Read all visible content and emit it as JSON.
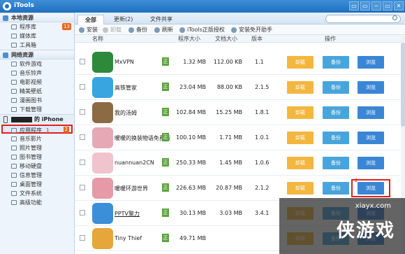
{
  "app": {
    "title": "iTools"
  },
  "window_buttons": [
    "▭",
    "▭",
    "─",
    "▭",
    "✕"
  ],
  "sidebar": {
    "local_section": "本地资源",
    "local_items": [
      {
        "label": "程序库",
        "badge": "13"
      },
      {
        "label": "媒体库"
      },
      {
        "label": "工具箱"
      }
    ],
    "network_section": "网络资源",
    "network_items": [
      {
        "label": "软件游戏"
      },
      {
        "label": "音乐铃声"
      },
      {
        "label": "电影视频"
      },
      {
        "label": "精美壁纸"
      },
      {
        "label": "漫画图书"
      },
      {
        "label": "下载管理"
      }
    ],
    "device_label": "的 iPhone",
    "device_items": [
      {
        "label": "应用程序",
        "num1": "1",
        "num2": "2"
      },
      {
        "label": "音乐影片"
      },
      {
        "label": "照片管理"
      },
      {
        "label": "图书管理"
      },
      {
        "label": "移动硬盘"
      },
      {
        "label": "信息管理"
      },
      {
        "label": "桌面管理"
      },
      {
        "label": "文件系统"
      },
      {
        "label": "高级功能"
      }
    ]
  },
  "tabs": [
    {
      "label": "全部"
    },
    {
      "label": "更新(2)"
    },
    {
      "label": "文件共享"
    }
  ],
  "toolbar": {
    "install": "安装",
    "uninstall": "卸载",
    "backup": "备份",
    "refresh": "刷新",
    "itools_auth": "iTools正版授权",
    "jailbreak_free": "安装免开助手"
  },
  "table_headers": {
    "name": "名称",
    "program_size": "程序大小",
    "doc_size": "文档大小",
    "version": "版本",
    "actions": "操作"
  },
  "row_buttons": {
    "uninstall": "卸载",
    "backup": "备份",
    "browse": "浏览"
  },
  "verified_label": "正",
  "rows": [
    {
      "name": "MxVPN",
      "program_size": "1.32 MB",
      "doc_size": "112.00 KB",
      "version": "1.1",
      "color": "#2c8a3a"
    },
    {
      "name": "高铁管家",
      "program_size": "23.04 MB",
      "doc_size": "88.00 KB",
      "version": "2.1.5",
      "color": "#38a5e0"
    },
    {
      "name": "我的汤姆",
      "program_size": "102.84 MB",
      "doc_size": "15.25 MB",
      "version": "1.8.1",
      "color": "#8c6a44"
    },
    {
      "name": "暖暖的换装物语免费版",
      "program_size": "100.10 MB",
      "doc_size": "1.71 MB",
      "version": "1.0.1",
      "color": "#e7a8b6"
    },
    {
      "name": "nuannuan2CN",
      "program_size": "250.33 MB",
      "doc_size": "1.45 MB",
      "version": "1.0.6",
      "color": "#f0c4cd"
    },
    {
      "name": "暖暖环游世界",
      "program_size": "226.63 MB",
      "doc_size": "20.87 MB",
      "version": "2.1.2",
      "color": "#e69aa8",
      "highlight": "2"
    },
    {
      "name": "PPTV聚力",
      "program_size": "30.13 MB",
      "doc_size": "3.03 MB",
      "version": "3.4.1",
      "color": "#3a8fd8"
    },
    {
      "name": "Tiny Thief",
      "program_size": "49.71 MB",
      "doc_size": "",
      "version": "",
      "color": "#e6a63a"
    }
  ],
  "search": {
    "placeholder": ""
  },
  "watermark": {
    "url": "xiayx.com",
    "text": "侠游戏"
  }
}
